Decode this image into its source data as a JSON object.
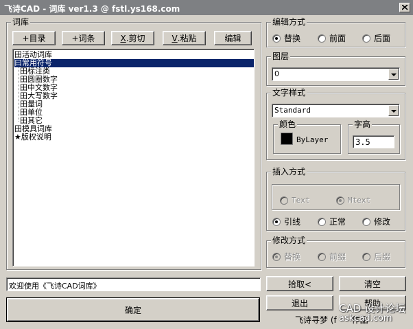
{
  "window": {
    "title": "飞诗CAD - 词库 ver1.3 @ fstl.ys168.com"
  },
  "library": {
    "group_label": "词库",
    "buttons": {
      "add_dir": "+目录",
      "add_entry": "+词条",
      "cut_key": "X",
      "cut_label": ".剪切",
      "paste_key": "V",
      "paste_label": ".粘贴",
      "edit": "编辑"
    },
    "tree": [
      {
        "label": "田活动词库",
        "selected": false,
        "child": false
      },
      {
        "label": "曰常用符号",
        "selected": true,
        "child": false
      },
      {
        "label": "田标注类",
        "selected": false,
        "child": true
      },
      {
        "label": "田圆圈数字",
        "selected": false,
        "child": true
      },
      {
        "label": "田中文数字",
        "selected": false,
        "child": true
      },
      {
        "label": "田大写数字",
        "selected": false,
        "child": true
      },
      {
        "label": "田量词",
        "selected": false,
        "child": true
      },
      {
        "label": "田单位",
        "selected": false,
        "child": true
      },
      {
        "label": "田其它",
        "selected": false,
        "child": true
      },
      {
        "label": "田模具词库",
        "selected": false,
        "child": false
      },
      {
        "label": "★版权说明",
        "selected": false,
        "child": false
      }
    ]
  },
  "status": {
    "message": "欢迎使用《飞诗CAD词库》"
  },
  "ok_button": "确定",
  "edit_mode": {
    "label": "编辑方式",
    "options": [
      {
        "label": "替换",
        "checked": true
      },
      {
        "label": "前面",
        "checked": false
      },
      {
        "label": "后面",
        "checked": false
      }
    ]
  },
  "layer": {
    "label": "图层",
    "value": "0"
  },
  "text_style": {
    "label": "文字样式",
    "value": "Standard",
    "color": {
      "label": "颜色",
      "value": "ByLayer",
      "swatch": "#000000"
    },
    "height": {
      "label": "字高",
      "value": "3.5"
    }
  },
  "insert_mode": {
    "label": "插入方式",
    "text_types": [
      {
        "label": "Text",
        "checked": false
      },
      {
        "label": "Mtext",
        "checked": true
      }
    ],
    "options": [
      {
        "label": "引线",
        "checked": true
      },
      {
        "label": "正常",
        "checked": false
      },
      {
        "label": "修改",
        "checked": false
      }
    ]
  },
  "modify_mode": {
    "label": "修改方式",
    "options": [
      {
        "label": "替换",
        "checked": true
      },
      {
        "label": "前缀",
        "checked": false
      },
      {
        "label": "后缀",
        "checked": false
      }
    ]
  },
  "actions": {
    "pick": "拾取<",
    "clear": "清空",
    "exit": "退出",
    "help": "帮助"
  },
  "footer": {
    "credit": "飞诗寻梦 (f",
    "credit_tail": "作品",
    "watermark_top": "CAD 设计论坛",
    "watermark_bottom": "askcad.com"
  },
  "colors": {
    "selection": "#0a246a",
    "titlebar": "#7e8083",
    "face": "#d4d0c8"
  }
}
